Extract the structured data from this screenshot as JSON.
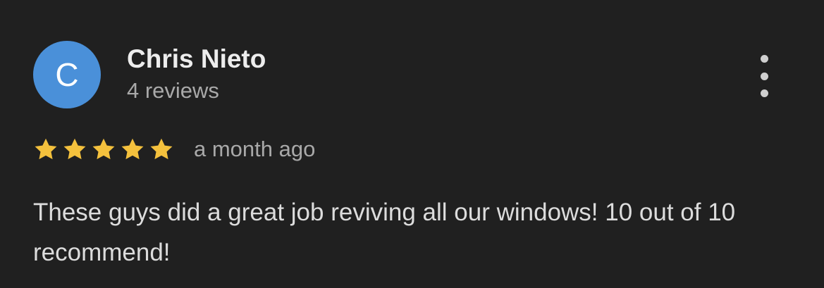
{
  "review": {
    "author": {
      "initial": "C",
      "name": "Chris Nieto",
      "reviews_count": "4 reviews",
      "avatar_color": "#4a90d9"
    },
    "rating": {
      "stars": 5,
      "max_stars": 5,
      "star_color": "#f4c13d",
      "star_icon": "star-icon"
    },
    "time_ago": "a month ago",
    "text": "These guys did a great job reviving all our windows! 10 out of 10 recommend!",
    "menu_icon": "more-vertical-icon"
  }
}
